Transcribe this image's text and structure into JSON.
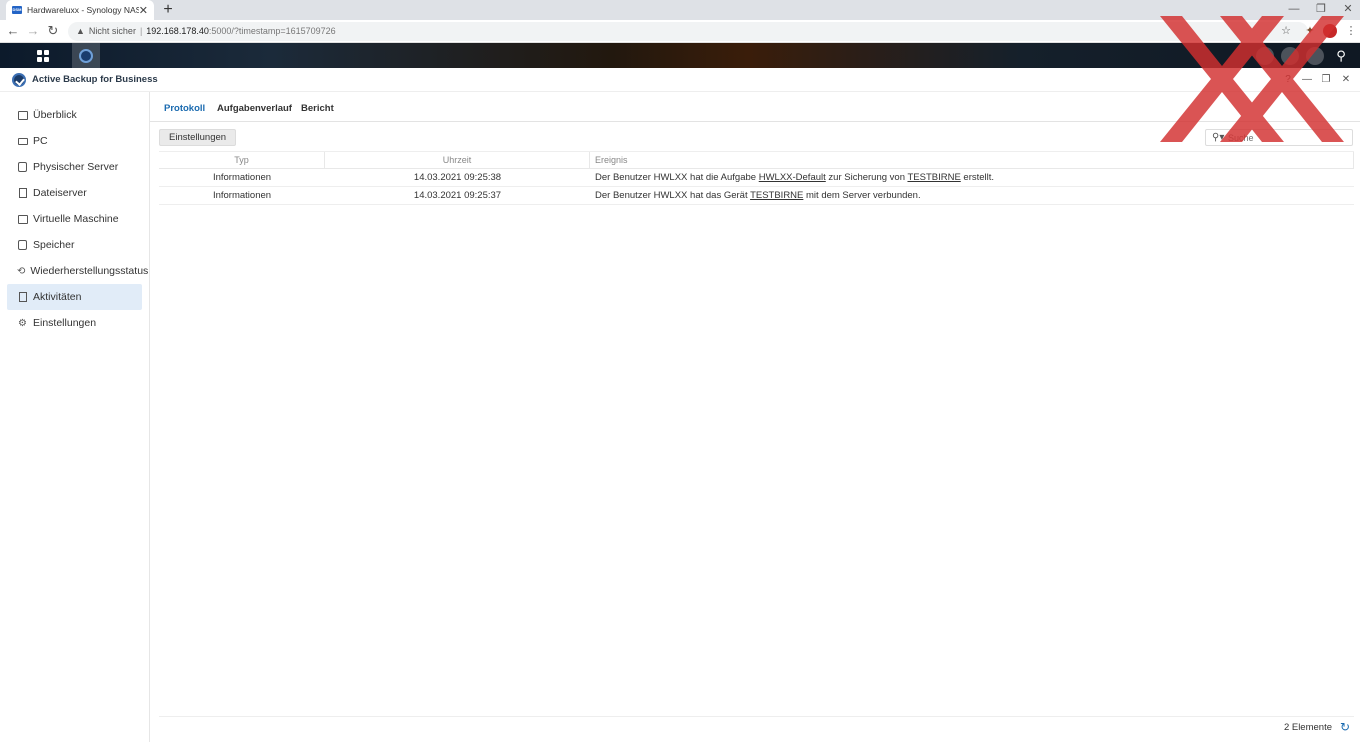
{
  "browser": {
    "tab_title": "Hardwareluxx - Synology NAS",
    "favicon_text": "DSM",
    "tab_close": "✕",
    "new_tab": "+",
    "security_label": "Nicht sicher",
    "url_host": "192.168.178.40",
    "url_path": ":5000/?timestamp=1615709726",
    "back": "←",
    "forward": "→",
    "reload": "↻"
  },
  "app": {
    "title": "Active Backup for Business"
  },
  "sidebar": {
    "items": [
      {
        "label": "Überblick",
        "icon": "overview-icon"
      },
      {
        "label": "PC",
        "icon": "pc-icon"
      },
      {
        "label": "Physischer Server",
        "icon": "server-icon"
      },
      {
        "label": "Dateiserver",
        "icon": "fileserver-icon"
      },
      {
        "label": "Virtuelle Maschine",
        "icon": "vm-icon"
      },
      {
        "label": "Speicher",
        "icon": "storage-icon"
      },
      {
        "label": "Wiederherstellungsstatus",
        "icon": "restore-icon"
      },
      {
        "label": "Aktivitäten",
        "icon": "activity-icon",
        "active": true
      },
      {
        "label": "Einstellungen",
        "icon": "gear-icon"
      }
    ]
  },
  "tabs": [
    {
      "label": "Protokoll",
      "active": true
    },
    {
      "label": "Aufgabenverlauf"
    },
    {
      "label": "Bericht"
    }
  ],
  "toolbar": {
    "settings_label": "Einstellungen"
  },
  "search": {
    "placeholder": "Suche"
  },
  "table": {
    "columns": [
      "Typ",
      "Uhrzeit",
      "Ereignis"
    ],
    "rows": [
      {
        "type": "Informationen",
        "time": "14.03.2021 09:25:38",
        "event_pre": "Der Benutzer HWLXX hat die Aufgabe ",
        "event_link1": "HWLXX-Default",
        "event_mid": " zur Sicherung von ",
        "event_link2": "TESTBIRNE",
        "event_post": " erstellt."
      },
      {
        "type": "Informationen",
        "time": "14.03.2021 09:25:37",
        "event_pre": "Der Benutzer HWLXX hat das Gerät ",
        "event_link1": "TESTBIRNE",
        "event_mid": " mit dem Server verbunden.",
        "event_link2": "",
        "event_post": ""
      }
    ]
  },
  "footer": {
    "count": "2 Elemente"
  },
  "colors": {
    "accent": "#1b6bb0",
    "active_bg": "#e1ecf8",
    "watermark": "#d32f2f"
  }
}
